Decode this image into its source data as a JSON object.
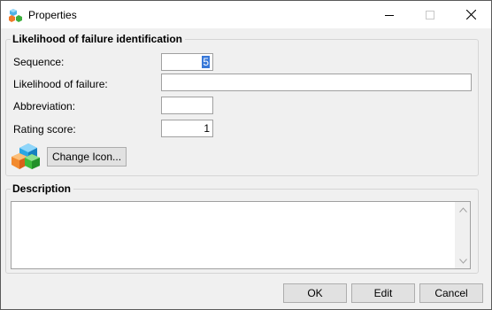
{
  "window": {
    "title": "Properties",
    "icons": {
      "app": "cubes-icon",
      "minimize": "minimize-icon",
      "maximize": "maximize-icon",
      "close": "close-icon"
    }
  },
  "identification": {
    "group_title": "Likelihood of failure identification",
    "sequence_label": "Sequence:",
    "sequence_value": "5",
    "likelihood_label": "Likelihood of failure:",
    "likelihood_value": "",
    "abbreviation_label": "Abbreviation:",
    "abbreviation_value": "",
    "rating_label": "Rating score:",
    "rating_value": "1",
    "change_icon_label": "Change Icon..."
  },
  "description": {
    "group_title": "Description",
    "value": ""
  },
  "buttons": {
    "ok": "OK",
    "edit": "Edit",
    "cancel": "Cancel"
  }
}
